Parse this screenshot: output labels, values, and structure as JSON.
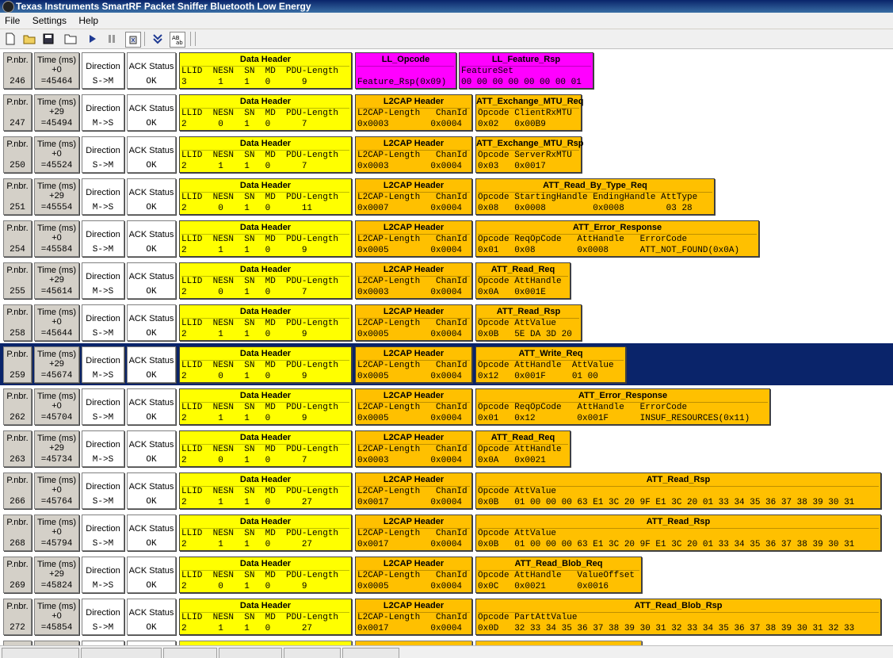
{
  "window": {
    "title": "Texas Instruments SmartRF Packet Sniffer Bluetooth Low Energy"
  },
  "menu": [
    "File",
    "Settings",
    "Help"
  ],
  "toolbar_icons": [
    "new-icon",
    "open-icon",
    "save-icon",
    "folder-icon",
    "play-icon",
    "pause-icon",
    "clear-icon",
    "autoscroll-icon",
    "text-view-icon"
  ],
  "labels": {
    "pnbr": "P.nbr.",
    "time": "Time (ms)",
    "direction": "Direction",
    "ack": "ACK Status"
  },
  "colors": {
    "data_header": "#ffff00",
    "l2cap": "#ffc000",
    "ll": "#ff00ff",
    "selected": "#0a246a"
  },
  "packets": [
    {
      "n": "246",
      "delta": "+0",
      "time": "=45464",
      "dir": "S->M",
      "ack": "OK",
      "blocks": [
        {
          "c": "yellow",
          "w": 218,
          "title": "Data Header",
          "l1": "LLID  NESN  SN  MD  PDU-Length",
          "l2": "3      1    1   0      9"
        },
        {
          "c": "magenta",
          "w": 128,
          "title": "LL_Opcode",
          "l1": "",
          "l2": "Feature_Rsp(0x09)"
        },
        {
          "c": "magenta",
          "w": 170,
          "title": "LL_Feature_Rsp",
          "l1": "FeatureSet",
          "l2": "00 00 00 00 00 00 00 01"
        }
      ]
    },
    {
      "n": "247",
      "delta": "+29",
      "time": "=45494",
      "dir": "M->S",
      "ack": "OK",
      "blocks": [
        {
          "c": "yellow",
          "w": 218,
          "title": "Data Header",
          "l1": "LLID  NESN  SN  MD  PDU-Length",
          "l2": "2      0    1   0      7"
        },
        {
          "c": "orange",
          "w": 148,
          "title": "L2CAP Header",
          "l1": "L2CAP-Length   ChanId",
          "l2": "0x0003        0x0004"
        },
        {
          "c": "orange",
          "w": 134,
          "title": "ATT_Exchange_MTU_Req",
          "l1": "Opcode ClientRxMTU",
          "l2": "0x02   0x00B9"
        }
      ]
    },
    {
      "n": "250",
      "delta": "+0",
      "time": "=45524",
      "dir": "S->M",
      "ack": "OK",
      "blocks": [
        {
          "c": "yellow",
          "w": 218,
          "title": "Data Header",
          "l1": "LLID  NESN  SN  MD  PDU-Length",
          "l2": "2      1    1   0      7"
        },
        {
          "c": "orange",
          "w": 148,
          "title": "L2CAP Header",
          "l1": "L2CAP-Length   ChanId",
          "l2": "0x0003        0x0004"
        },
        {
          "c": "orange",
          "w": 134,
          "title": "ATT_Exchange_MTU_Rsp",
          "l1": "Opcode ServerRxMTU",
          "l2": "0x03   0x0017"
        }
      ]
    },
    {
      "n": "251",
      "delta": "+29",
      "time": "=45554",
      "dir": "M->S",
      "ack": "OK",
      "blocks": [
        {
          "c": "yellow",
          "w": 218,
          "title": "Data Header",
          "l1": "LLID  NESN  SN  MD  PDU-Length",
          "l2": "2      0    1   0      11"
        },
        {
          "c": "orange",
          "w": 148,
          "title": "L2CAP Header",
          "l1": "L2CAP-Length   ChanId",
          "l2": "0x0007        0x0004"
        },
        {
          "c": "orange",
          "w": 302,
          "title": "ATT_Read_By_Type_Req",
          "l1": "Opcode StartingHandle EndingHandle AttType",
          "l2": "0x08   0x0008         0x0008        03 28"
        }
      ]
    },
    {
      "n": "254",
      "delta": "+0",
      "time": "=45584",
      "dir": "S->M",
      "ack": "OK",
      "blocks": [
        {
          "c": "yellow",
          "w": 218,
          "title": "Data Header",
          "l1": "LLID  NESN  SN  MD  PDU-Length",
          "l2": "2      1    1   0      9"
        },
        {
          "c": "orange",
          "w": 148,
          "title": "L2CAP Header",
          "l1": "L2CAP-Length   ChanId",
          "l2": "0x0005        0x0004"
        },
        {
          "c": "orange",
          "w": 358,
          "title": "ATT_Error_Response",
          "l1": "Opcode ReqOpCode   AttHandle   ErrorCode",
          "l2": "0x01   0x08        0x0008      ATT_NOT_FOUND(0x0A)"
        }
      ]
    },
    {
      "n": "255",
      "delta": "+29",
      "time": "=45614",
      "dir": "M->S",
      "ack": "OK",
      "blocks": [
        {
          "c": "yellow",
          "w": 218,
          "title": "Data Header",
          "l1": "LLID  NESN  SN  MD  PDU-Length",
          "l2": "2      0    1   0      7"
        },
        {
          "c": "orange",
          "w": 148,
          "title": "L2CAP Header",
          "l1": "L2CAP-Length   ChanId",
          "l2": "0x0003        0x0004"
        },
        {
          "c": "orange",
          "w": 120,
          "title": "ATT_Read_Req",
          "l1": "Opcode AttHandle",
          "l2": "0x0A   0x001E"
        }
      ]
    },
    {
      "n": "258",
      "delta": "+0",
      "time": "=45644",
      "dir": "S->M",
      "ack": "OK",
      "blocks": [
        {
          "c": "yellow",
          "w": 218,
          "title": "Data Header",
          "l1": "LLID  NESN  SN  MD  PDU-Length",
          "l2": "2      1    1   0      9"
        },
        {
          "c": "orange",
          "w": 148,
          "title": "L2CAP Header",
          "l1": "L2CAP-Length   ChanId",
          "l2": "0x0005        0x0004"
        },
        {
          "c": "orange",
          "w": 134,
          "title": "ATT_Read_Rsp",
          "l1": "Opcode AttValue",
          "l2": "0x0B   5E DA 3D 20"
        }
      ]
    },
    {
      "n": "259",
      "delta": "+29",
      "time": "=45674",
      "dir": "M->S",
      "ack": "OK",
      "selected": true,
      "blocks": [
        {
          "c": "yellow",
          "w": 218,
          "title": "Data Header",
          "l1": "LLID  NESN  SN  MD  PDU-Length",
          "l2": "2      0    1   0      9"
        },
        {
          "c": "orange",
          "w": 148,
          "title": "L2CAP Header",
          "l1": "L2CAP-Length   ChanId",
          "l2": "0x0005        0x0004"
        },
        {
          "c": "orange",
          "w": 190,
          "title": "ATT_Write_Req",
          "l1": "Opcode AttHandle  AttValue",
          "l2": "0x12   0x001F     01 00"
        }
      ]
    },
    {
      "n": "262",
      "delta": "+0",
      "time": "=45704",
      "dir": "S->M",
      "ack": "OK",
      "blocks": [
        {
          "c": "yellow",
          "w": 218,
          "title": "Data Header",
          "l1": "LLID  NESN  SN  MD  PDU-Length",
          "l2": "2      1    1   0      9"
        },
        {
          "c": "orange",
          "w": 148,
          "title": "L2CAP Header",
          "l1": "L2CAP-Length   ChanId",
          "l2": "0x0005        0x0004"
        },
        {
          "c": "orange",
          "w": 372,
          "title": "ATT_Error_Response",
          "l1": "Opcode ReqOpCode   AttHandle   ErrorCode",
          "l2": "0x01   0x12        0x001F      INSUF_RESOURCES(0x11)"
        }
      ]
    },
    {
      "n": "263",
      "delta": "+29",
      "time": "=45734",
      "dir": "M->S",
      "ack": "OK",
      "blocks": [
        {
          "c": "yellow",
          "w": 218,
          "title": "Data Header",
          "l1": "LLID  NESN  SN  MD  PDU-Length",
          "l2": "2      0    1   0      7"
        },
        {
          "c": "orange",
          "w": 148,
          "title": "L2CAP Header",
          "l1": "L2CAP-Length   ChanId",
          "l2": "0x0003        0x0004"
        },
        {
          "c": "orange",
          "w": 120,
          "title": "ATT_Read_Req",
          "l1": "Opcode AttHandle",
          "l2": "0x0A   0x0021"
        }
      ]
    },
    {
      "n": "266",
      "delta": "+0",
      "time": "=45764",
      "dir": "S->M",
      "ack": "OK",
      "blocks": [
        {
          "c": "yellow",
          "w": 218,
          "title": "Data Header",
          "l1": "LLID  NESN  SN  MD  PDU-Length",
          "l2": "2      1    1   0      27"
        },
        {
          "c": "orange",
          "w": 148,
          "title": "L2CAP Header",
          "l1": "L2CAP-Length   ChanId",
          "l2": "0x0017        0x0004"
        },
        {
          "c": "orange",
          "w": 512,
          "title": "ATT_Read_Rsp",
          "l1": "Opcode AttValue",
          "l2": "0x0B   01 00 00 00 63 E1 3C 20 9F E1 3C 20 01 33 34 35 36 37 38 39 30 31"
        }
      ]
    },
    {
      "n": "268",
      "delta": "+0",
      "time": "=45794",
      "dir": "S->M",
      "ack": "OK",
      "blocks": [
        {
          "c": "yellow",
          "w": 218,
          "title": "Data Header",
          "l1": "LLID  NESN  SN  MD  PDU-Length",
          "l2": "2      1    1   0      27"
        },
        {
          "c": "orange",
          "w": 148,
          "title": "L2CAP Header",
          "l1": "L2CAP-Length   ChanId",
          "l2": "0x0017        0x0004"
        },
        {
          "c": "orange",
          "w": 512,
          "title": "ATT_Read_Rsp",
          "l1": "Opcode AttValue",
          "l2": "0x0B   01 00 00 00 63 E1 3C 20 9F E1 3C 20 01 33 34 35 36 37 38 39 30 31"
        }
      ]
    },
    {
      "n": "269",
      "delta": "+29",
      "time": "=45824",
      "dir": "M->S",
      "ack": "OK",
      "blocks": [
        {
          "c": "yellow",
          "w": 218,
          "title": "Data Header",
          "l1": "LLID  NESN  SN  MD  PDU-Length",
          "l2": "2      0    1   0      9"
        },
        {
          "c": "orange",
          "w": 148,
          "title": "L2CAP Header",
          "l1": "L2CAP-Length   ChanId",
          "l2": "0x0005        0x0004"
        },
        {
          "c": "orange",
          "w": 210,
          "title": "ATT_Read_Blob_Req",
          "l1": "Opcode AttHandle   ValueOffset",
          "l2": "0x0C   0x0021      0x0016"
        }
      ]
    },
    {
      "n": "272",
      "delta": "+0",
      "time": "=45854",
      "dir": "S->M",
      "ack": "OK",
      "blocks": [
        {
          "c": "yellow",
          "w": 218,
          "title": "Data Header",
          "l1": "LLID  NESN  SN  MD  PDU-Length",
          "l2": "2      1    1   0      27"
        },
        {
          "c": "orange",
          "w": 148,
          "title": "L2CAP Header",
          "l1": "L2CAP-Length   ChanId",
          "l2": "0x0017        0x0004"
        },
        {
          "c": "orange",
          "w": 512,
          "title": "ATT_Read_Blob_Rsp",
          "l1": "Opcode PartAttValue",
          "l2": "0x0D   32 33 34 35 36 37 38 39 30 31 32 33 34 35 36 37 38 39 30 31 32 33"
        }
      ]
    }
  ]
}
